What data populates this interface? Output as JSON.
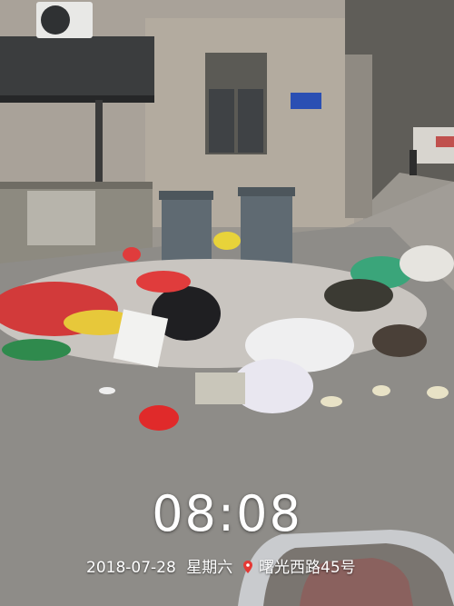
{
  "photo": {
    "time": "08:08",
    "date": "2018-07-28",
    "weekday": "星期六",
    "location": "曙光西路45号",
    "location_icon": "map-pin-icon",
    "accent_pin_color": "#e53935"
  }
}
